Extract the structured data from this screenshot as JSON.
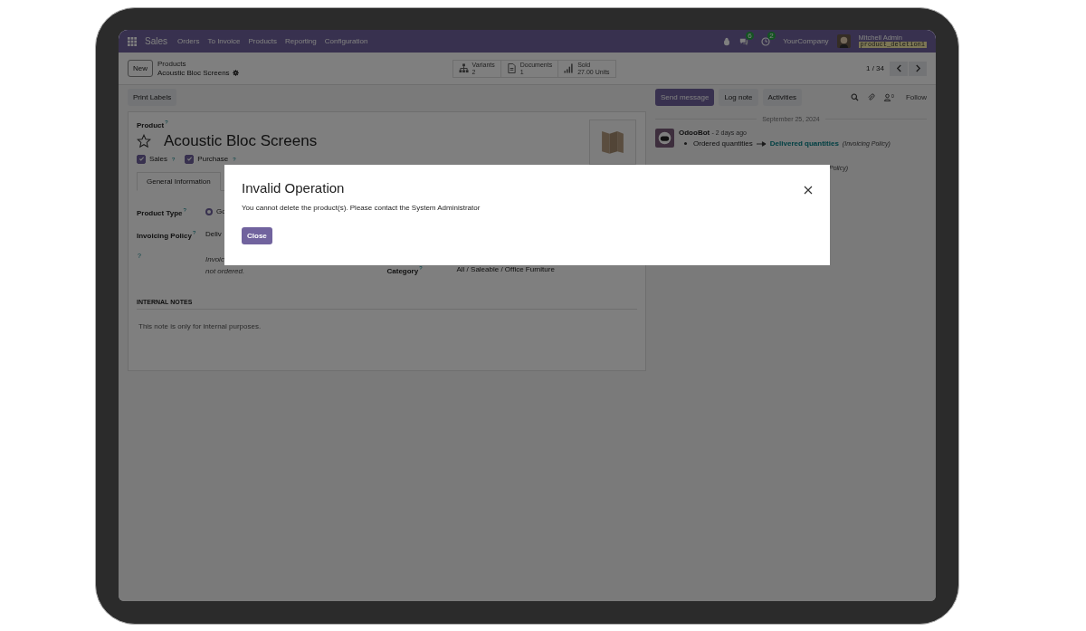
{
  "navbar": {
    "app_name": "Sales",
    "menu": [
      "Orders",
      "To Invoice",
      "Products",
      "Reporting",
      "Configuration"
    ],
    "messages_badge": "6",
    "activities_badge": "2",
    "company": "YourCompany",
    "user": "Mitchell Admin",
    "database": "product_deletion1"
  },
  "control_panel": {
    "new_button": "New",
    "breadcrumb": "Products",
    "record_title": "Acoustic Bloc Screens",
    "smart_buttons": [
      {
        "kind": "variants",
        "label": "Variants",
        "value": "2"
      },
      {
        "kind": "documents",
        "label": "Documents",
        "value": "1"
      },
      {
        "kind": "sold",
        "label": "Sold",
        "value": "27.00 Units"
      }
    ],
    "pager": "1 / 34"
  },
  "form": {
    "action_buttons": [
      "Print Labels"
    ],
    "name_label": "Product",
    "help_mark": "?",
    "name": "Acoustic Bloc Screens",
    "favorite": false,
    "checkboxes": [
      {
        "label": "Sales",
        "checked": true,
        "help_mark": "?"
      },
      {
        "label": "Purchase",
        "checked": true,
        "help_mark": "?"
      }
    ],
    "tabs": [
      {
        "label": "General Information",
        "selected": true
      }
    ],
    "fields": [
      {
        "kind": "radio",
        "label": "Product Type",
        "help_mark": "?",
        "value": "Go",
        "selected": true
      },
      {
        "kind": "text",
        "label": "Invoicing Policy",
        "help_mark": "?",
        "value": "Deliv"
      }
    ],
    "help_row": {
      "mark": "?",
      "lines": [
        "Invoic",
        "not ordered."
      ]
    },
    "category": {
      "label": "Category",
      "help_mark": "?",
      "value": "All / Saleable / Office Furniture"
    },
    "notes": {
      "heading": "INTERNAL NOTES",
      "placeholder": "This note is only for internal purposes."
    }
  },
  "chatter": {
    "buttons": [
      {
        "label": "Send message",
        "primary": true
      },
      {
        "label": "Log note",
        "primary": false
      },
      {
        "label": "Activities",
        "primary": false
      }
    ],
    "followers_count": "0",
    "follow": "Follow",
    "date": "September 25, 2024",
    "messages": [
      {
        "kind": "full",
        "author": "OdooBot",
        "time": "- 2 days ago",
        "from": "Ordered quantities",
        "to": "Delivered quantities",
        "field": "(Invoicing Policy)"
      },
      {
        "kind": "covered",
        "field": "Policy)"
      }
    ]
  },
  "dialog": {
    "title": "Invalid Operation",
    "message": "You cannot delete the product(s). Please contact the System Administrator",
    "button": "Close"
  }
}
